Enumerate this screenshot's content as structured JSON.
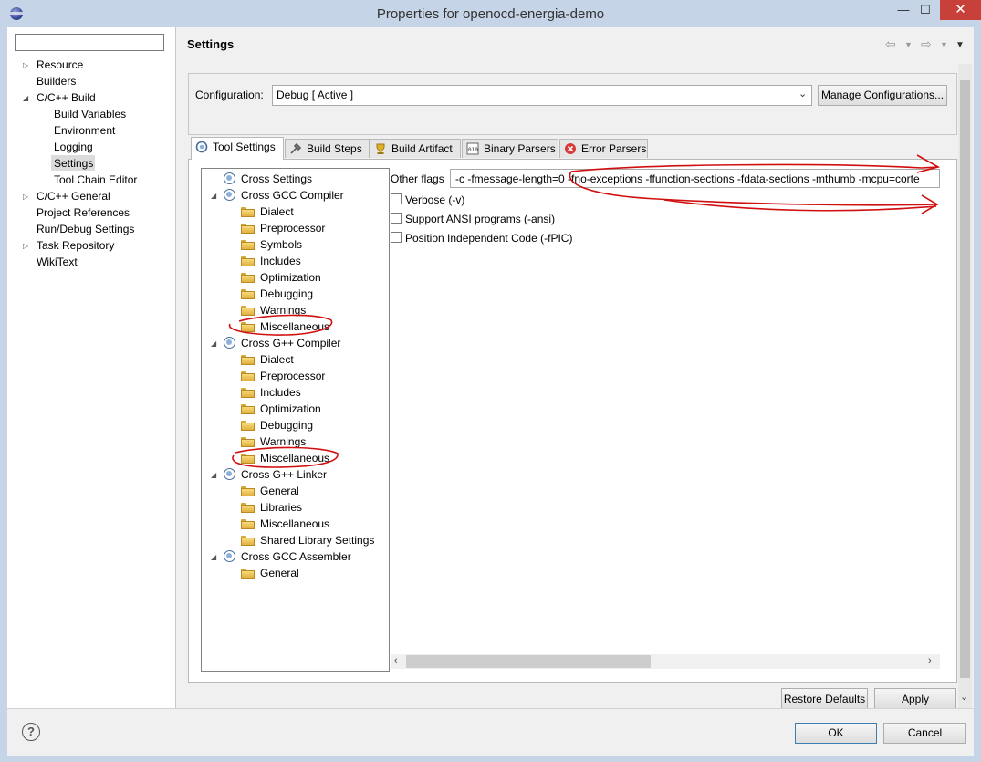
{
  "window": {
    "title": "Properties for openocd-energia-demo",
    "minimize_glyph": "—",
    "maximize_glyph": "☐",
    "close_glyph": "✕"
  },
  "nav": {
    "filter_value": "",
    "items": [
      {
        "label": "Resource",
        "expander": "closed"
      },
      {
        "label": "Builders",
        "expander": "none"
      },
      {
        "label": "C/C++ Build",
        "expander": "open"
      },
      {
        "label": "Build Variables",
        "expander": "none"
      },
      {
        "label": "Environment",
        "expander": "none"
      },
      {
        "label": "Logging",
        "expander": "none"
      },
      {
        "label": "Settings",
        "expander": "none",
        "selected": true
      },
      {
        "label": "Tool Chain Editor",
        "expander": "none"
      },
      {
        "label": "C/C++ General",
        "expander": "closed"
      },
      {
        "label": "Project References",
        "expander": "none"
      },
      {
        "label": "Run/Debug Settings",
        "expander": "none"
      },
      {
        "label": "Task Repository",
        "expander": "closed"
      },
      {
        "label": "WikiText",
        "expander": "none"
      }
    ]
  },
  "page": {
    "title": "Settings",
    "nav_back_icon": "back-arrow-icon",
    "nav_forward_icon": "forward-arrow-icon",
    "menu_icon": "view-menu-icon"
  },
  "configuration": {
    "label": "Configuration:",
    "value": "Debug  [ Active ]",
    "manage_button": "Manage Configurations..."
  },
  "tabs": [
    {
      "label": "Tool Settings",
      "icon": "tool-settings-icon",
      "active": true
    },
    {
      "label": "Build Steps",
      "icon": "build-steps-icon"
    },
    {
      "label": "Build Artifact",
      "icon": "build-artifact-icon"
    },
    {
      "label": "Binary Parsers",
      "icon": "binary-parsers-icon"
    },
    {
      "label": "Error Parsers",
      "icon": "error-parsers-icon"
    }
  ],
  "tool_tree": [
    {
      "label": "Cross Settings",
      "kind": "tool",
      "level": 0
    },
    {
      "label": "Cross GCC Compiler",
      "kind": "tool",
      "level": 0,
      "expanded": true
    },
    {
      "label": "Dialect",
      "kind": "folder",
      "level": 1
    },
    {
      "label": "Preprocessor",
      "kind": "folder",
      "level": 1
    },
    {
      "label": "Symbols",
      "kind": "folder",
      "level": 1
    },
    {
      "label": "Includes",
      "kind": "folder",
      "level": 1
    },
    {
      "label": "Optimization",
      "kind": "folder",
      "level": 1
    },
    {
      "label": "Debugging",
      "kind": "folder",
      "level": 1
    },
    {
      "label": "Warnings",
      "kind": "folder",
      "level": 1
    },
    {
      "label": "Miscellaneous",
      "kind": "folder",
      "level": 1,
      "highlight": true
    },
    {
      "label": "Cross G++ Compiler",
      "kind": "tool",
      "level": 0,
      "expanded": true
    },
    {
      "label": "Dialect",
      "kind": "folder",
      "level": 1
    },
    {
      "label": "Preprocessor",
      "kind": "folder",
      "level": 1
    },
    {
      "label": "Includes",
      "kind": "folder",
      "level": 1
    },
    {
      "label": "Optimization",
      "kind": "folder",
      "level": 1
    },
    {
      "label": "Debugging",
      "kind": "folder",
      "level": 1
    },
    {
      "label": "Warnings",
      "kind": "folder",
      "level": 1
    },
    {
      "label": "Miscellaneous",
      "kind": "folder",
      "level": 1,
      "highlight": true
    },
    {
      "label": "Cross G++ Linker",
      "kind": "tool",
      "level": 0,
      "expanded": true
    },
    {
      "label": "General",
      "kind": "folder",
      "level": 1
    },
    {
      "label": "Libraries",
      "kind": "folder",
      "level": 1
    },
    {
      "label": "Miscellaneous",
      "kind": "folder",
      "level": 1
    },
    {
      "label": "Shared Library Settings",
      "kind": "folder",
      "level": 1
    },
    {
      "label": "Cross GCC Assembler",
      "kind": "tool",
      "level": 0,
      "expanded": true
    },
    {
      "label": "General",
      "kind": "folder",
      "level": 1
    }
  ],
  "misc_settings": {
    "other_flags_label": "Other flags",
    "other_flags_value": "-c -fmessage-length=0 -fno-exceptions -ffunction-sections -fdata-sections -mthumb -mcpu=corte",
    "checkboxes": [
      {
        "label": "Verbose (-v)",
        "checked": false
      },
      {
        "label": "Support ANSI programs (-ansi)",
        "checked": false
      },
      {
        "label": "Position Independent Code (-fPIC)",
        "checked": false
      }
    ]
  },
  "scrollbars": {
    "left_glyph": "‹",
    "right_glyph": "›",
    "down_glyph": "⌄"
  },
  "buttons": {
    "restore_defaults": "Restore Defaults",
    "apply": "Apply",
    "ok": "OK",
    "cancel": "Cancel",
    "help": "?"
  },
  "annotation_color": "#d01010"
}
